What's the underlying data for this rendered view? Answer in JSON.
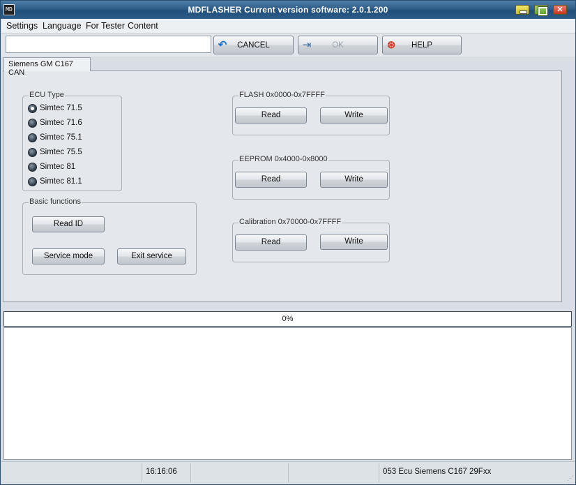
{
  "window": {
    "title": "MDFLASHER  Current version software: 2.0.1.200",
    "icon_text": "MD"
  },
  "menu": [
    "Settings",
    "Language",
    "For Tester",
    "Content"
  ],
  "toolbar": {
    "input_value": "",
    "cancel_label": "CANCEL",
    "ok_label": "OK",
    "help_label": "HELP"
  },
  "tab": {
    "label": "Siemens GM C167  CAN"
  },
  "ecu_type": {
    "title": "ECU Type",
    "options": [
      "Simtec 71.5",
      "Simtec 71.6",
      "Simtec 75.1",
      "Simtec 75.5",
      "Simtec 81",
      "Simtec 81.1"
    ],
    "selected": "Simtec 71.5"
  },
  "basic": {
    "title": "Basic functions",
    "read_id": "Read ID",
    "service_mode": "Service mode",
    "exit_service": "Exit service"
  },
  "flash": {
    "title": "FLASH 0x0000-0x7FFFF",
    "read": "Read",
    "write": "Write"
  },
  "eeprom": {
    "title": "EEPROM 0x4000-0x8000",
    "read": "Read",
    "write": "Write"
  },
  "calibration": {
    "title": "Calibration  0x70000-0x7FFFF",
    "read": "Read",
    "write": "Write"
  },
  "progress": {
    "text": "0%",
    "value": 0
  },
  "status": {
    "time": "16:16:06",
    "ecu": "053 Ecu Siemens C167 29Fxx"
  },
  "colors": {
    "titlebar": "#2e5d88",
    "progress_fill": "#3a8f3a"
  },
  "icons": {
    "cancel": "undo-arrow-icon",
    "ok": "door-enter-icon",
    "help": "lifebuoy-icon"
  }
}
